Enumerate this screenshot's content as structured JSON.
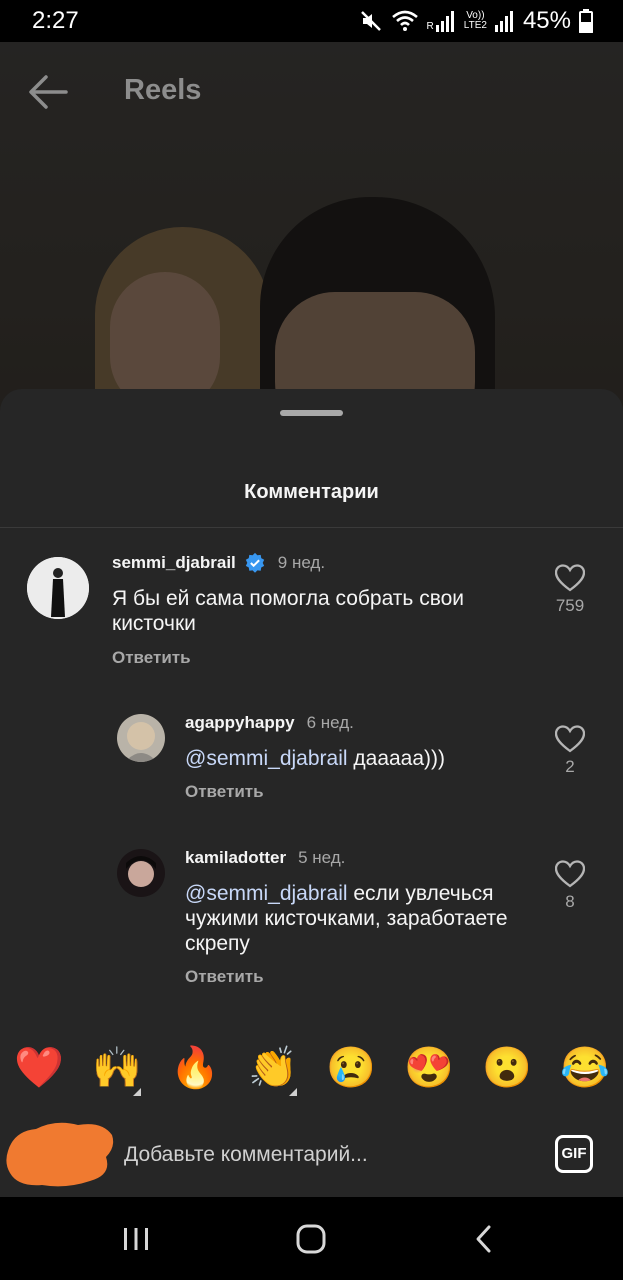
{
  "status_bar": {
    "time": "2:27",
    "battery": "45%",
    "network_r": "R",
    "volte_top": "Vo))",
    "volte_bottom": "LTE2"
  },
  "header": {
    "title": "Reels"
  },
  "sheet": {
    "title": "Комментарии"
  },
  "comments": [
    {
      "username": "semmi_djabrail",
      "verified": true,
      "time": "9 нед.",
      "text": "Я бы ей сама помогла собрать свои кисточки",
      "reply_label": "Ответить",
      "likes": "759"
    },
    {
      "username": "agappyhappy",
      "time": "6 нед.",
      "mention": "@semmi_djabrail",
      "text": " дааааа)))",
      "reply_label": "Ответить",
      "likes": "2"
    },
    {
      "username": "kamiladotter",
      "time": "5 нед.",
      "mention": "@semmi_djabrail",
      "text": " если увлечься чужими кисточками, заработаете скрепу",
      "reply_label": "Ответить",
      "likes": "8"
    }
  ],
  "emoji_bar": [
    "❤️",
    "🙌",
    "🔥",
    "👏",
    "😢",
    "😍",
    "😮",
    "😂"
  ],
  "input": {
    "placeholder": "Добавьте комментарий...",
    "gif_label": "GIF"
  },
  "colors": {
    "sheet_bg": "#262626",
    "verified": "#3897f0",
    "redaction": "#f07a30"
  }
}
